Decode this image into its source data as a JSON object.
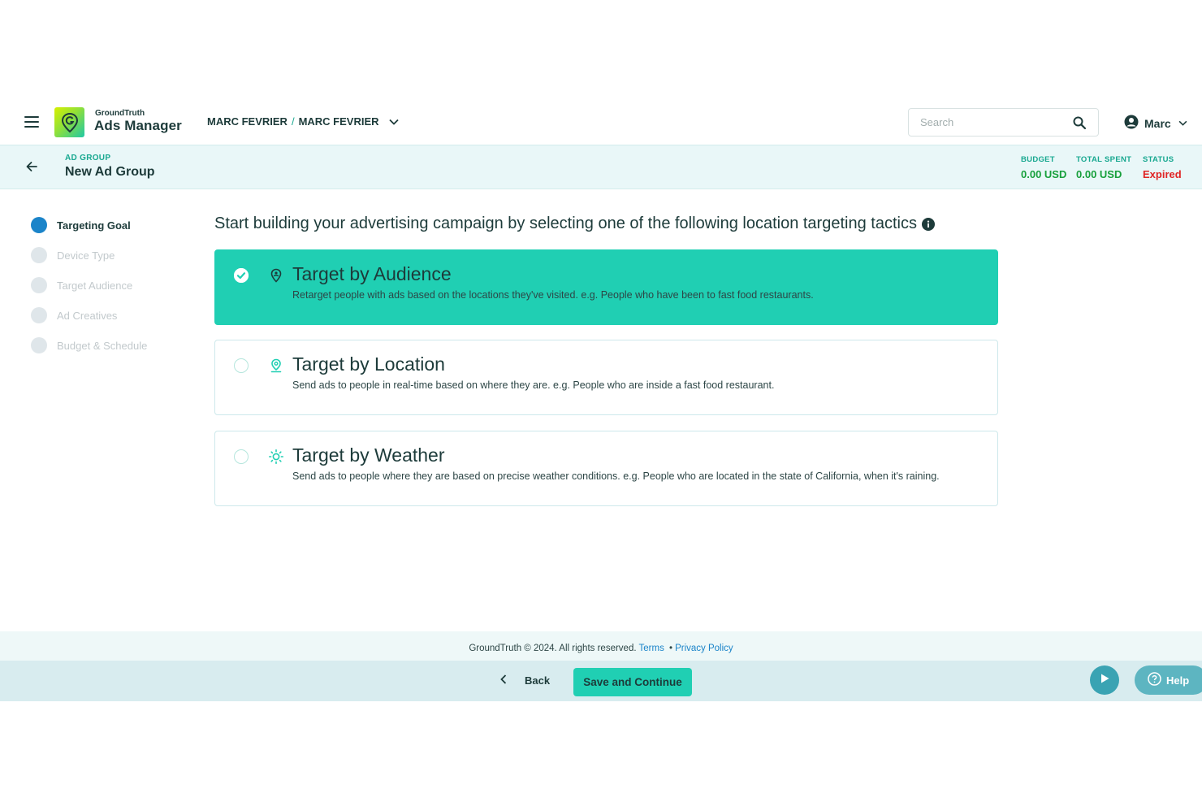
{
  "header": {
    "brand_small": "GroundTruth",
    "brand_main": "Ads Manager",
    "account_org": "MARC FEVRIER",
    "account_separator": "/",
    "account_name": "MARC FEVRIER",
    "search_placeholder": "Search",
    "user_name": "Marc",
    "icons": [
      "menu-icon",
      "logo-icon",
      "chevron-down-icon",
      "search-icon",
      "user-icon"
    ]
  },
  "ad_group_bar": {
    "label": "AD GROUP",
    "title": "New Ad Group",
    "stats": [
      {
        "key": "BUDGET",
        "value": "0.00 USD"
      },
      {
        "key": "TOTAL SPENT",
        "value": "0.00 USD"
      },
      {
        "key": "STATUS",
        "value": "Expired"
      }
    ]
  },
  "steps": [
    {
      "label": "Targeting Goal",
      "active": true
    },
    {
      "label": "Device Type",
      "active": false
    },
    {
      "label": "Target Audience",
      "active": false
    },
    {
      "label": "Ad Creatives",
      "active": false
    },
    {
      "label": "Budget & Schedule",
      "active": false
    }
  ],
  "main": {
    "headline": "Start building your advertising campaign by selecting one of the following location targeting tactics",
    "options": [
      {
        "title": "Target by Audience",
        "description": "Retarget people with ads based on the locations they've visited. e.g. People who have been to fast food restaurants.",
        "icon": "audience-pin-icon",
        "selected": true
      },
      {
        "title": "Target by Location",
        "description": "Send ads to people in real-time based on where they are. e.g. People who are inside a fast food restaurant.",
        "icon": "location-pin-icon",
        "selected": false
      },
      {
        "title": "Target by Weather",
        "description": "Send ads to people where they are based on precise weather conditions. e.g. People who are located in the state of California, when it's raining.",
        "icon": "sun-icon",
        "selected": false
      }
    ]
  },
  "footer": {
    "copyright": "GroundTruth © 2024. All rights reserved.",
    "terms_label": "Terms",
    "bullet": "•",
    "privacy_label": "Privacy Policy",
    "back_label": "Back",
    "save_label": "Save and Continue",
    "help_label": "Help"
  },
  "colors": {
    "accent": "#20cfb3",
    "dark_text": "#1d3b3a",
    "step_active": "#1b84c9",
    "status_expired": "#e02525",
    "money_green": "#18a03c",
    "link_blue": "#1b84c9"
  }
}
